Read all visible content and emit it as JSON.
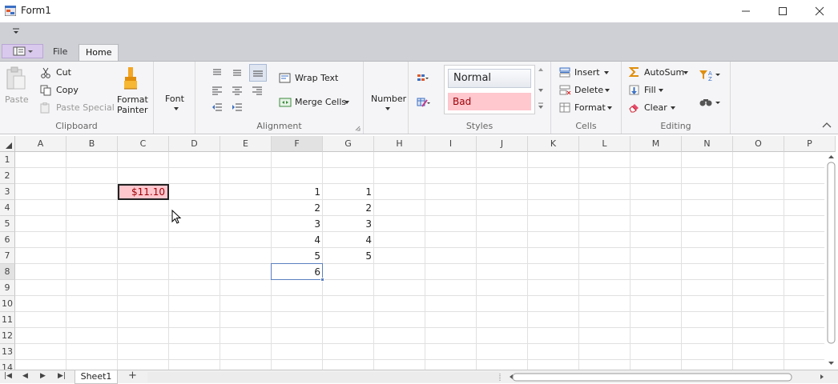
{
  "window": {
    "title": "Form1"
  },
  "tabs": {
    "file": "File",
    "home": "Home"
  },
  "ribbon": {
    "clipboard": {
      "label": "Clipboard",
      "paste": "Paste",
      "cut": "Cut",
      "copy": "Copy",
      "paste_special": "Paste Special",
      "format_painter_1": "Format",
      "format_painter_2": "Painter"
    },
    "font": {
      "label": "Font"
    },
    "alignment": {
      "label": "Alignment",
      "wrap_text": "Wrap Text",
      "merge_cells": "Merge Cells"
    },
    "number": {
      "label": "Number"
    },
    "styles": {
      "label": "Styles",
      "normal": "Normal",
      "bad": "Bad"
    },
    "cells": {
      "label": "Cells",
      "insert": "Insert",
      "delete": "Delete",
      "format": "Format"
    },
    "editing": {
      "label": "Editing",
      "autosum": "AutoSum",
      "fill": "Fill",
      "clear": "Clear"
    }
  },
  "grid": {
    "columns": [
      "A",
      "B",
      "C",
      "D",
      "E",
      "F",
      "G",
      "H",
      "I",
      "J",
      "K",
      "L",
      "M",
      "N",
      "O",
      "P"
    ],
    "rows": [
      "1",
      "2",
      "3",
      "4",
      "5",
      "6",
      "7",
      "8",
      "9",
      "10",
      "11",
      "12",
      "13",
      "14"
    ],
    "selected_column": "F",
    "selected_row": "8",
    "cells": {
      "C3": "$11.10",
      "F3": "1",
      "F4": "2",
      "F5": "3",
      "F6": "4",
      "F7": "5",
      "F8": "6",
      "G3": "1",
      "G4": "2",
      "G5": "3",
      "G6": "4",
      "G7": "5"
    }
  },
  "sheets": {
    "active": "Sheet1",
    "add": "+"
  },
  "colors": {
    "bad_fill": "#ffc7ce",
    "bad_text": "#9c0006",
    "selection": "#5b80c0"
  }
}
